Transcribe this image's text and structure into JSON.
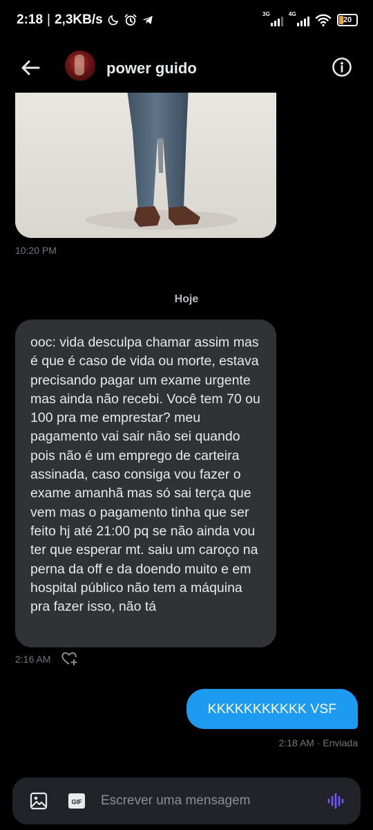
{
  "status_bar": {
    "time": "2:18",
    "separator": "|",
    "speed": "2,3KB/s",
    "network_1": "3G",
    "network_2": "4G",
    "battery": "20"
  },
  "header": {
    "contact_name": "power guido"
  },
  "messages": {
    "image_time": "10:20 PM",
    "day_separator": "Hoje",
    "received_text": "ooc: vida desculpa chamar assim mas é que é caso de vida ou morte, estava precisando pagar um exame urgente mas ainda não recebi. Você tem 70 ou 100 pra me emprestar? meu pagamento vai sair não sei quando pois não é um emprego de carteira assinada, caso consiga vou fazer o exame amanhã mas só sai terça que vem mas o pagamento tinha que ser feito hj até 21:00 pq se não ainda vou ter que esperar mt. saiu um caroço na perna da off e da doendo muito e em hospital público não tem a máquina pra fazer isso, não tá",
    "received_time": "2:16 AM",
    "sent_text": "KKKKKKKKKKK VSF",
    "sent_status": "2:18 AM · Enviada"
  },
  "composer": {
    "placeholder": "Escrever uma mensagem",
    "gif_label": "GIF"
  },
  "colors": {
    "background": "#000000",
    "received_bubble": "#2f3336",
    "sent_bubble": "#1d9bf0",
    "secondary_text": "#71767b",
    "accent_voice": "#7856ff"
  },
  "icons": {
    "status": [
      "moon-icon",
      "alarm-icon",
      "telegram-icon",
      "signal-icon",
      "wifi-icon",
      "battery-icon"
    ],
    "header": [
      "back-arrow-icon",
      "info-icon"
    ],
    "composer": [
      "image-icon",
      "gif-icon",
      "voice-icon"
    ],
    "reaction": "heart-plus-icon"
  }
}
